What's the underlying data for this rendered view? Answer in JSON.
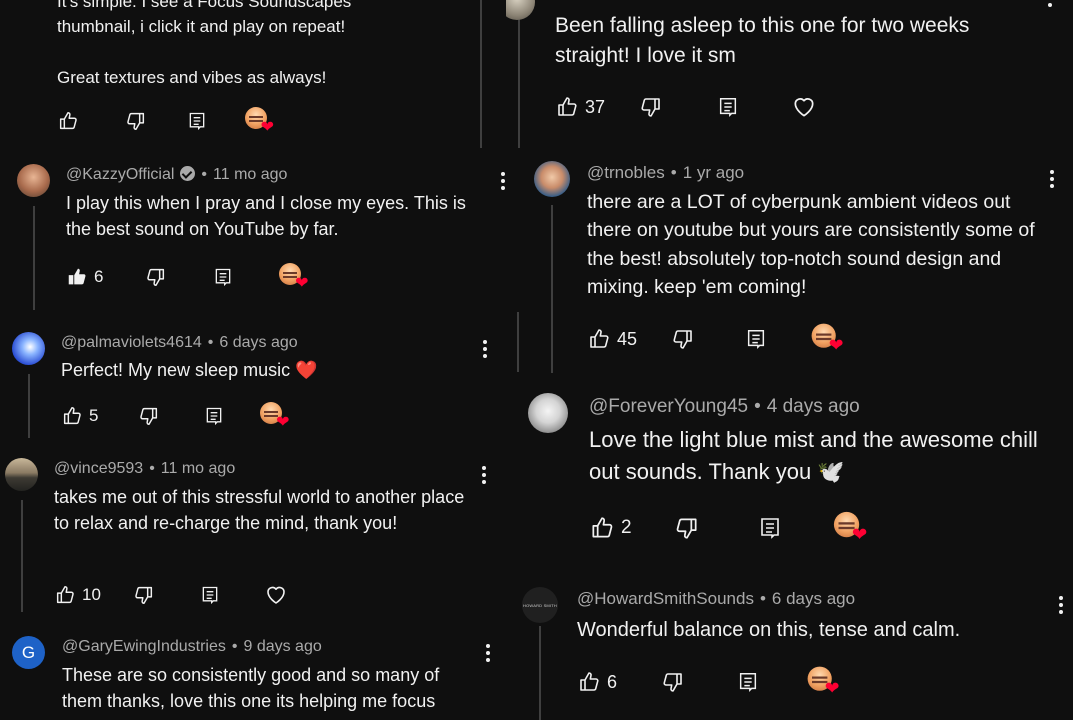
{
  "left": {
    "top_partial": {
      "text1": "It's simple. I see a Focus Soundscapes thumbnail, i click it and play on repeat!",
      "text2": "Great textures and vibes as always!"
    },
    "comments": [
      {
        "handle": "@KazzyOfficial",
        "time": "11 mo ago",
        "text": "I play this when I pray and I close my eyes. This is the best sound on YouTube by far.",
        "likes": "6"
      },
      {
        "handle": "@palmaviolets4614",
        "time": "6 days ago",
        "text": "Perfect! My new sleep music ❤️",
        "likes": "5"
      },
      {
        "handle": "@vince9593",
        "time": "11 mo ago",
        "text": "takes me out of this stressful world to another place to relax and re-charge the mind, thank you!",
        "likes": "10"
      },
      {
        "handle": "@GaryEwingIndustries",
        "time": "9 days ago",
        "text": "These are so consistently good and so many of them thanks, love this one its helping me focus",
        "avatar_letter": "G"
      }
    ]
  },
  "right": {
    "top_partial": {
      "text": "Been falling asleep to this one for two weeks straight! I love it sm",
      "likes": "37"
    },
    "comments": [
      {
        "handle": "@trnobles",
        "time": "1 yr ago",
        "text": "there are a LOT of cyberpunk ambient videos out there on youtube but yours are consistently some of the best! absolutely top-notch sound design and mixing. keep 'em coming!",
        "likes": "45"
      },
      {
        "handle": "@ForeverYoung45",
        "time": "4 days ago",
        "text": "Love the light blue mist and the awesome chill out sounds. Thank you 🕊️",
        "likes": "2"
      },
      {
        "handle": "@HowardSmithSounds",
        "time": "6 days ago",
        "text": "Wonderful balance on this, tense and calm.",
        "likes": "6",
        "avatar_text": "HOWARD SMITH"
      }
    ]
  },
  "ui": {
    "separator": "•"
  }
}
